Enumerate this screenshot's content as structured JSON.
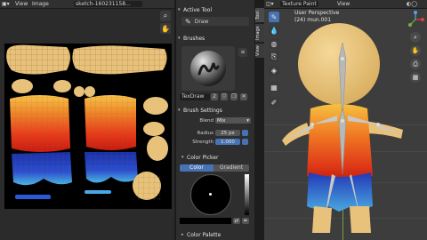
{
  "image_editor": {
    "menu": [
      "View",
      "Image"
    ],
    "image_name": "sketch-160231158..."
  },
  "properties": {
    "active_tool_header": "Active Tool",
    "tool_name": "Draw",
    "brushes_header": "Brushes",
    "brush_name": "TexDraw",
    "brush_users": "2",
    "brush_settings_header": "Brush Settings",
    "blend_label": "Blend",
    "blend_value": "Mix",
    "radius_label": "Radius",
    "radius_value": "25 px",
    "strength_label": "Strength",
    "strength_value": "1.000",
    "color_picker_header": "Color Picker",
    "color_tab": "Color",
    "gradient_tab": "Gradient",
    "color_palette_header": "Color Palette",
    "side_tabs": [
      "Tool",
      "Image",
      "View"
    ]
  },
  "viewport": {
    "mode_label": "Texture Paint",
    "perspective_label": "User Perspective",
    "object_label": "(24) mun.001",
    "menu": [
      "View"
    ]
  },
  "colors": {
    "accent": "#4772b3",
    "panel_bg": "#2e2e2e",
    "viewport_bg": "#3d3d3d"
  }
}
